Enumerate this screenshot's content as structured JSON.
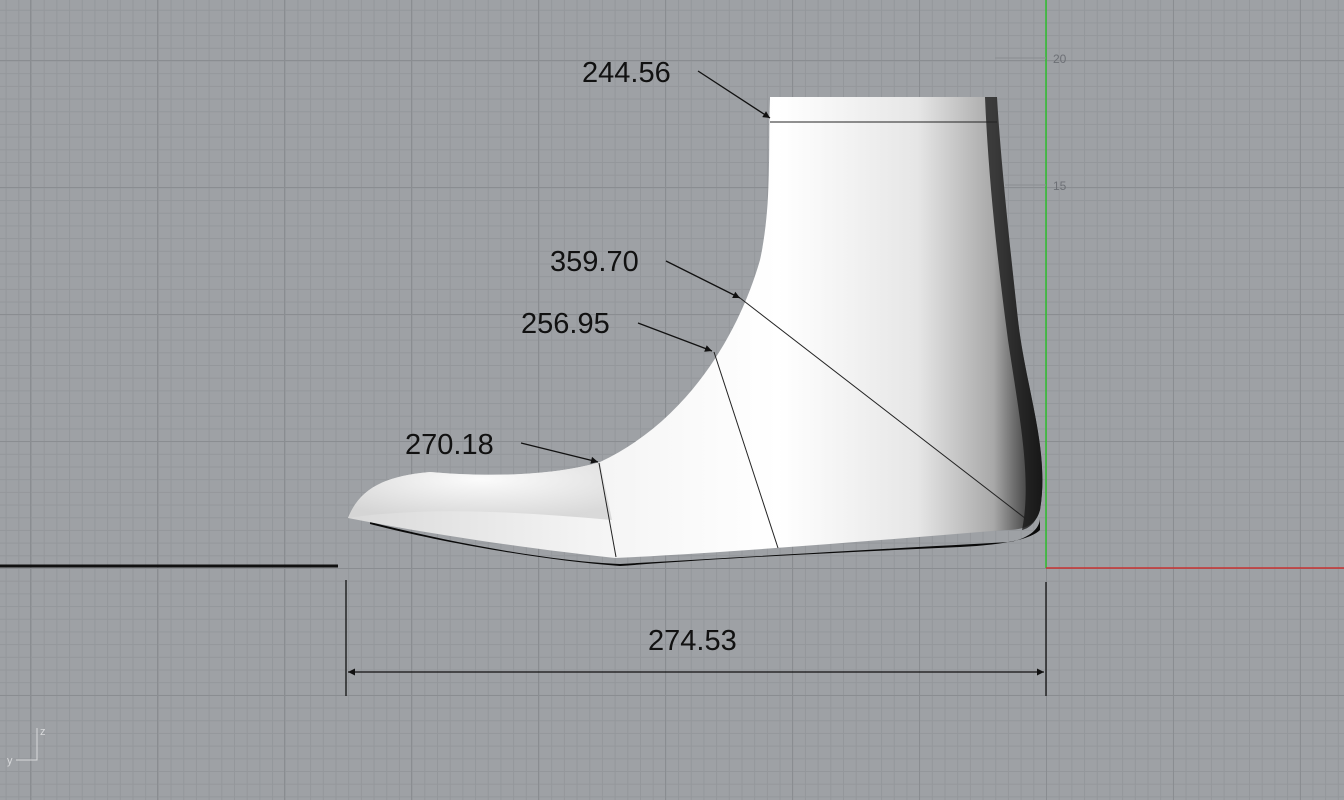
{
  "viewport": {
    "view": "Right",
    "axis_labels": {
      "vertical": "z",
      "horizontal": "y"
    },
    "ruler_ticks": [
      "20",
      "15"
    ],
    "colors": {
      "grid_background": "#9ea1a5",
      "z_axis": "#2fbf2f",
      "y_axis": "#c83232",
      "dimension": "#111111"
    }
  },
  "dimensions": {
    "top_girth": "244.56",
    "instep_girth": "359.70",
    "waist_girth": "256.95",
    "ball_girth": "270.18",
    "length": "274.53"
  }
}
